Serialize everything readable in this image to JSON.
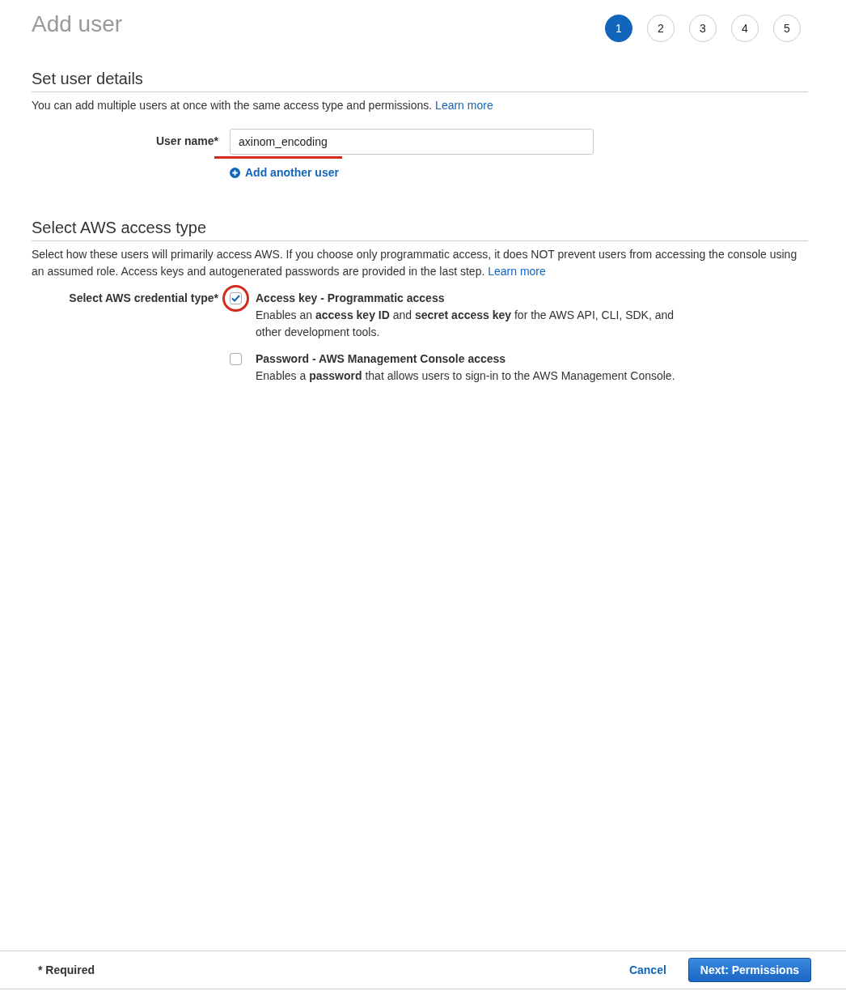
{
  "title": "Add user",
  "steps": [
    {
      "label": "1",
      "selected": true
    },
    {
      "label": "2",
      "selected": false
    },
    {
      "label": "3",
      "selected": false
    },
    {
      "label": "4",
      "selected": false
    },
    {
      "label": "5",
      "selected": false
    }
  ],
  "details": {
    "heading": "Set user details",
    "intro": "You can add multiple users at once with the same access type and permissions.",
    "learn_more": "Learn more",
    "user_name_label": "User name*",
    "user_name_value": "axinom_encoding",
    "add_another": "Add another user"
  },
  "access": {
    "heading": "Select AWS access type",
    "intro": "Select how these users will primarily access AWS. If you choose only programmatic access, it does NOT prevent users from accessing the console using an assumed role. Access keys and autogenerated passwords are provided in the last step.",
    "learn_more": "Learn more",
    "credential_label": "Select AWS credential type*",
    "options": [
      {
        "title": "Access key - Programmatic access",
        "description": "Enables an **access key ID** and **secret access key** for the AWS API, CLI, SDK, and other development tools.",
        "checked": true
      },
      {
        "title": "Password - AWS Management Console access",
        "description": "Enables a **password** that allows users to sign-in to the AWS Management Console.",
        "checked": false
      }
    ]
  },
  "footer": {
    "required": "* Required",
    "cancel": "Cancel",
    "next": "Next: Permissions"
  }
}
